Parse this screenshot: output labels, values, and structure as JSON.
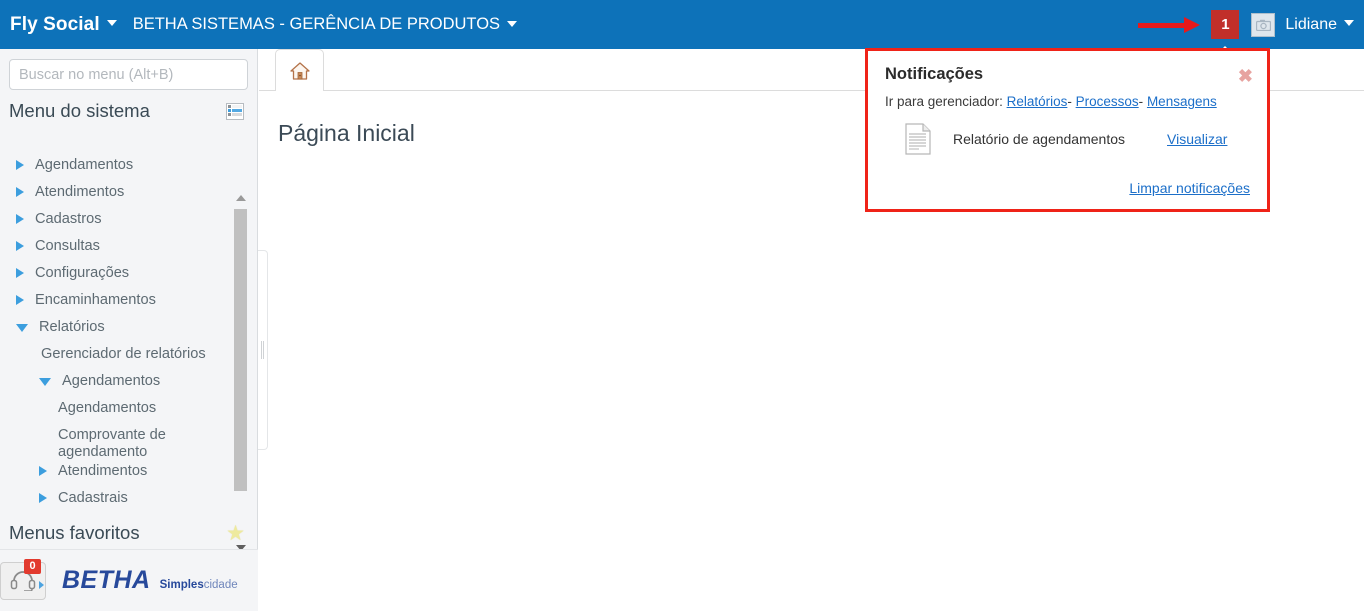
{
  "topbar": {
    "brand": "Fly Social",
    "org": "BETHA SISTEMAS - GERÊNCIA DE PRODUTOS",
    "notification_count": "1",
    "user_name": "Lidiane",
    "avatar_icon": "camera-icon",
    "brand_caret_icon": "caret-down-icon",
    "org_caret_icon": "caret-down-icon",
    "user_caret_icon": "caret-down-icon",
    "badge_color": "#c12f2a",
    "bar_color": "#0d72b9",
    "annotation_arrow_color": "#e8191b"
  },
  "notifications": {
    "title": "Notificações",
    "close_icon": "close-icon",
    "go_to_manager_label": "Ir para gerenciador:",
    "manager_links": [
      "Relatórios",
      "Processos",
      "Mensagens"
    ],
    "separator": "-",
    "items": [
      {
        "icon": "document-icon",
        "label": "Relatório de agendamentos",
        "action": "Visualizar"
      }
    ],
    "clear_label": "Limpar notificações",
    "border_color": "#ef2318",
    "link_color": "#1c6fc9"
  },
  "sidebar": {
    "search": {
      "placeholder": "Buscar no menu (Alt+B)",
      "value": ""
    },
    "menu_header": {
      "title": "Menu do sistema",
      "icon": "list-view-icon"
    },
    "tree": [
      {
        "label": "Agendamentos",
        "level": 0,
        "state": "collapsed"
      },
      {
        "label": "Atendimentos",
        "level": 0,
        "state": "collapsed"
      },
      {
        "label": "Cadastros",
        "level": 0,
        "state": "collapsed"
      },
      {
        "label": "Consultas",
        "level": 0,
        "state": "collapsed"
      },
      {
        "label": "Configurações",
        "level": 0,
        "state": "collapsed"
      },
      {
        "label": "Encaminhamentos",
        "level": 0,
        "state": "collapsed"
      },
      {
        "label": "Relatórios",
        "level": 0,
        "state": "expanded"
      },
      {
        "label": "Gerenciador de relatórios",
        "level": 1,
        "state": "leaf"
      },
      {
        "label": "Agendamentos",
        "level": 1,
        "state": "expanded"
      },
      {
        "label": "Agendamentos",
        "level": 2,
        "state": "leaf"
      },
      {
        "label": "Comprovante de agendamento",
        "level": 2,
        "state": "leaf"
      },
      {
        "label": "Atendimentos",
        "level": 1,
        "state": "collapsed"
      },
      {
        "label": "Cadastrais",
        "level": 1,
        "state": "collapsed"
      }
    ],
    "favorites_header": {
      "title": "Menus favoritos",
      "icon": "star-icon"
    },
    "footer": {
      "support_icon": "headset-icon",
      "support_badge": "0",
      "logo_primary": "BETHA",
      "logo_secondary_bold": "Simples",
      "logo_secondary_light": "cidade"
    },
    "scrollbar": {
      "up_icon": "scroll-up-icon",
      "down_icon": "scroll-down-icon"
    }
  },
  "main": {
    "tabs": [
      {
        "icon": "home-icon",
        "label": "",
        "active": true
      }
    ],
    "page_title": "Página Inicial"
  },
  "splitter": {
    "name": "sidebar-resize-handle"
  }
}
